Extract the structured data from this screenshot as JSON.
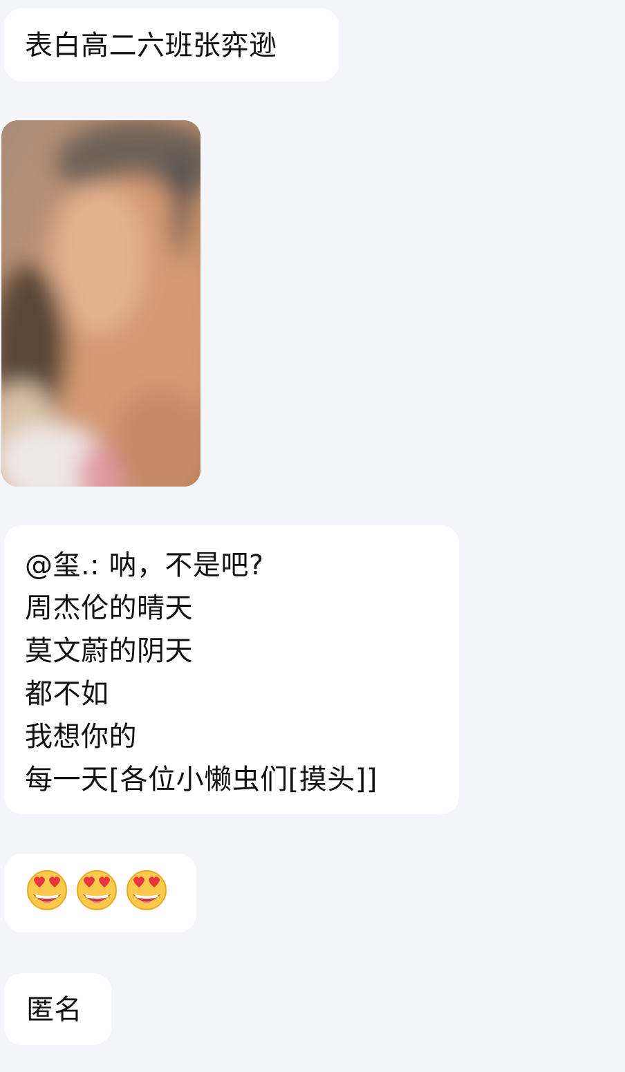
{
  "messages": [
    {
      "type": "text",
      "text": "表白高二六班张弈逊"
    },
    {
      "type": "image",
      "alt": ""
    },
    {
      "type": "text",
      "text": "@玺.: 呐，不是吧?\n周杰伦的晴天\n莫文蔚的阴天\n都不如\n我想你的\n每一天[各位小懒虫们[摸头]]"
    },
    {
      "type": "emoji",
      "icon": "heart-eyes-emoji",
      "count": 3
    },
    {
      "type": "text",
      "text": "匿名"
    }
  ],
  "colors": {
    "background": "#f4f5f9",
    "bubble": "#ffffff",
    "text": "#111111"
  }
}
